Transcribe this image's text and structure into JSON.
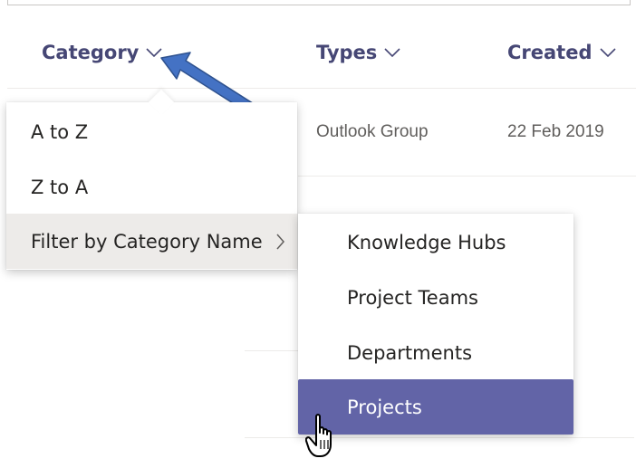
{
  "columns": {
    "category": "Category",
    "types": "Types",
    "created": "Created"
  },
  "row1": {
    "type": "Outlook Group",
    "created": "22 Feb 2019"
  },
  "sort_menu": {
    "items": [
      {
        "label": "A to Z"
      },
      {
        "label": "Z to A"
      },
      {
        "label": "Filter by Category Name"
      }
    ]
  },
  "filter_menu": {
    "items": [
      {
        "label": "Knowledge Hubs"
      },
      {
        "label": "Project Teams"
      },
      {
        "label": "Departments"
      },
      {
        "label": "Projects"
      }
    ],
    "selected": "Projects"
  },
  "colors": {
    "header_text": "#464775",
    "selected_bg": "#6264a7",
    "hover_bg": "#edebe9",
    "arrow_fill": "#4472c4",
    "arrow_stroke": "#2f528f"
  },
  "icons": [
    "chevron-down-icon",
    "chevron-right-icon",
    "hand-pointer-icon",
    "annotation-arrow"
  ]
}
